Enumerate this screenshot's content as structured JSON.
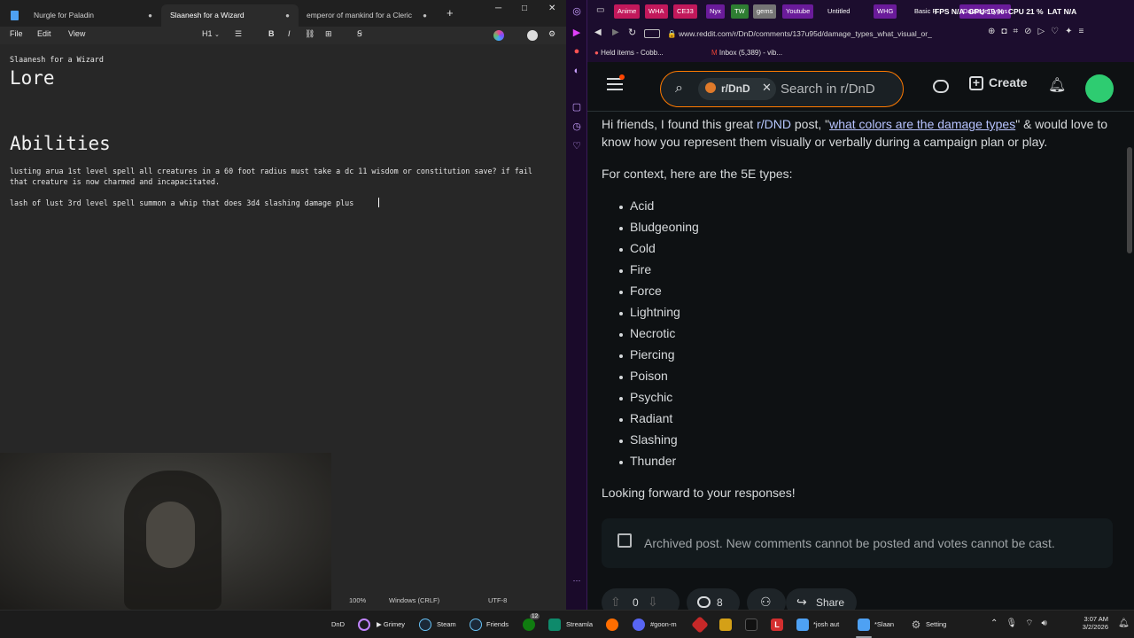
{
  "notepad": {
    "tabs": [
      {
        "label": "Nurgle for Paladin",
        "dot": "●"
      },
      {
        "label": "Slaanesh for a Wizard",
        "dot": "●"
      },
      {
        "label": "emperor of mankind for a Cleric",
        "dot": "●"
      }
    ],
    "add_tab": "+",
    "win_min": "─",
    "win_max": "□",
    "win_close": "✕",
    "menu": {
      "file": "File",
      "edit": "Edit",
      "view": "View"
    },
    "toolbar": {
      "heading": "H1",
      "bold": "B",
      "italic": "I"
    },
    "lines": {
      "title_line": "Slaanesh for a Wizard",
      "heading_lore": "Lore",
      "heading_abilities": "Abilities",
      "ability1_line1": "lusting arua 1st level spell all creatures in a 60 foot radius must take a dc 11 wisdom or constitution save? if fail",
      "ability1_line2": "that creature is now charmed and incapacitated.",
      "ability2_line1": "lash of lust 3rd level spell summon a whip that does 3d4 slashing damage plus"
    },
    "status": {
      "zoom": "100%",
      "line_ending": "Windows (CRLF)",
      "encoding": "UTF-8"
    }
  },
  "browser": {
    "bookmarks_top": [
      {
        "label": "Anime",
        "color": "#c2185b"
      },
      {
        "label": "WHA",
        "color": "#c2185b"
      },
      {
        "label": "CE33",
        "color": "#c2185b"
      },
      {
        "label": "Nyx",
        "color": "#6a1b9a"
      },
      {
        "label": "TW",
        "color": "#2e7d32"
      },
      {
        "label": "gems",
        "color": "#757575"
      },
      {
        "label": "Youtube",
        "color": "#6a1b9a"
      },
      {
        "label": "Untitled",
        "color": "transparent"
      },
      {
        "label": "WHG",
        "color": "#6a1b9a"
      },
      {
        "label": "Basic R",
        "color": "transparent"
      },
      {
        "label": "Damage Types",
        "color": "#6a1b9a"
      }
    ],
    "overlay_stats": {
      "fps": "FPS",
      "fps_val": "N/A",
      "gpu": "GPU",
      "gpu_val": "19 %",
      "cpu": "CPU",
      "cpu_val": "21 %",
      "lat": "LAT",
      "lat_val": "N/A"
    },
    "url": "www.reddit.com/r/DnD/comments/137u95d/damage_types_what_visual_or_",
    "bookmarks_bar": [
      {
        "label": "Held items - Cobb..."
      },
      {
        "label": "Inbox (5,389) - vib..."
      }
    ]
  },
  "reddit": {
    "community_chip": "r/DnD",
    "search_placeholder": "Search in r/DnD",
    "create_label": "Create",
    "intro_part1": "Hi friends, I found this great ",
    "intro_sub": "r/DND",
    "intro_part2": " post, \"",
    "intro_link": "what colors are the damage types",
    "intro_part3": "\" & would love to",
    "intro_line2": "know how you represent them visually or verbally during a campaign plan or play.",
    "context": "For context, here are the 5E types:",
    "damage_types": [
      "Acid",
      "Bludgeoning",
      "Cold",
      "Fire",
      "Force",
      "Lightning",
      "Necrotic",
      "Piercing",
      "Poison",
      "Psychic",
      "Radiant",
      "Slashing",
      "Thunder"
    ],
    "closing": "Looking forward to your responses!",
    "archived": "Archived post. New comments cannot be posted and votes cannot be cast.",
    "vote_count": "0",
    "comment_count": "8",
    "share_label": "Share"
  },
  "taskbar": {
    "items": [
      {
        "label": "DnD"
      },
      {
        "label": "Grimey"
      },
      {
        "label": "Steam"
      },
      {
        "label": "Friends"
      },
      {
        "label": "Streamla"
      },
      {
        "label": "#goon-m"
      },
      {
        "label": "*josh aut"
      },
      {
        "label": "*Slaan"
      },
      {
        "label": "Setting"
      }
    ],
    "time": "3:07 AM",
    "date": "3/2/2026",
    "badge": "12"
  }
}
